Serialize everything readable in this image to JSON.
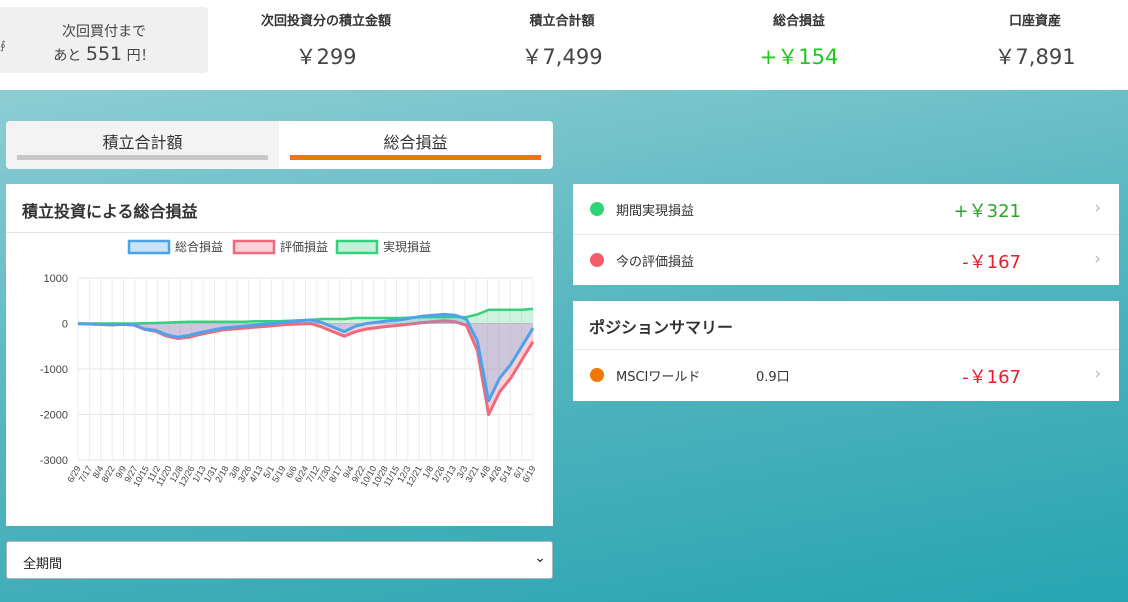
{
  "header": {
    "next_purchase": {
      "line1": "次回買付まで",
      "prefix": "あと",
      "amount": "551",
      "suffix": "円！"
    },
    "stats": [
      {
        "label": "次回投資分の積立金額",
        "value": "￥299",
        "positive": false
      },
      {
        "label": "積立合計額",
        "value": "￥7,499",
        "positive": false
      },
      {
        "label": "総合損益",
        "value": "+￥154",
        "positive": true
      },
      {
        "label": "口座資産",
        "value": "￥7,891",
        "positive": false
      }
    ]
  },
  "tabs": [
    {
      "label": "積立合計額",
      "active": false
    },
    {
      "label": "総合損益",
      "active": true
    }
  ],
  "chart_card": {
    "title": "積立投資による総合損益"
  },
  "period_select": {
    "value": "全期間"
  },
  "pl_items": [
    {
      "label": "期間実現損益",
      "value": "+￥321",
      "dot_color": "#2ed477",
      "sign": "pos"
    },
    {
      "label": "今の評価損益",
      "value": "-￥167",
      "dot_color": "#f35d6b",
      "sign": "neg"
    }
  ],
  "position_summary": {
    "title": "ポジションサマリー",
    "items": [
      {
        "name": "MSCIワールド",
        "qty": "0.9口",
        "value": "-￥167",
        "dot_color": "#f07800"
      }
    ]
  },
  "colors": {
    "accent": "#f07800",
    "positive": "#1fc71f",
    "negative": "#e8202a"
  },
  "chart_data": {
    "type": "area",
    "legend": [
      "総合損益",
      "評価損益",
      "実現損益"
    ],
    "legend_position": "top",
    "grid": true,
    "ylim": [
      -3000,
      1000
    ],
    "yticks": [
      "1000",
      "0",
      "-1000",
      "-2000",
      "-3000"
    ],
    "x": [
      "6/29",
      "7/17",
      "8/4",
      "8/22",
      "9/9",
      "9/27",
      "10/15",
      "11/2",
      "11/20",
      "12/8",
      "12/26",
      "1/13",
      "1/31",
      "2/18",
      "3/8",
      "3/26",
      "4/13",
      "5/1",
      "5/19",
      "6/6",
      "6/24",
      "7/12",
      "7/30",
      "8/17",
      "9/4",
      "9/22",
      "10/10",
      "10/28",
      "11/15",
      "12/3",
      "12/21",
      "1/8",
      "1/26",
      "2/13",
      "3/3",
      "3/21",
      "4/8",
      "4/26",
      "5/14",
      "6/1",
      "6/19"
    ],
    "series": [
      {
        "name": "総合損益",
        "color": "#4da3ea",
        "values": [
          -5,
          -10,
          -20,
          -30,
          -20,
          -30,
          -120,
          -150,
          -250,
          -300,
          -260,
          -200,
          -150,
          -100,
          -80,
          -60,
          -30,
          -10,
          10,
          40,
          60,
          80,
          20,
          -80,
          -180,
          -60,
          0,
          30,
          60,
          80,
          120,
          160,
          180,
          200,
          180,
          100,
          -400,
          -1700,
          -1200,
          -900,
          -500,
          -100
        ]
      },
      {
        "name": "評価損益",
        "color": "#ee6a7d",
        "values": [
          -5,
          -10,
          -20,
          -30,
          -20,
          -30,
          -130,
          -170,
          -280,
          -330,
          -300,
          -240,
          -190,
          -140,
          -120,
          -100,
          -80,
          -60,
          -40,
          -20,
          -10,
          0,
          -80,
          -180,
          -280,
          -180,
          -120,
          -90,
          -60,
          -40,
          -10,
          20,
          40,
          60,
          40,
          -40,
          -600,
          -2000,
          -1500,
          -1200,
          -800,
          -400
        ]
      },
      {
        "name": "実現損益",
        "color": "#36d17c",
        "values": [
          0,
          0,
          0,
          0,
          0,
          0,
          5,
          10,
          20,
          30,
          40,
          40,
          40,
          40,
          40,
          40,
          50,
          50,
          50,
          60,
          70,
          80,
          100,
          100,
          100,
          120,
          120,
          120,
          120,
          120,
          130,
          140,
          140,
          140,
          140,
          140,
          200,
          300,
          300,
          300,
          300,
          321
        ]
      }
    ]
  }
}
